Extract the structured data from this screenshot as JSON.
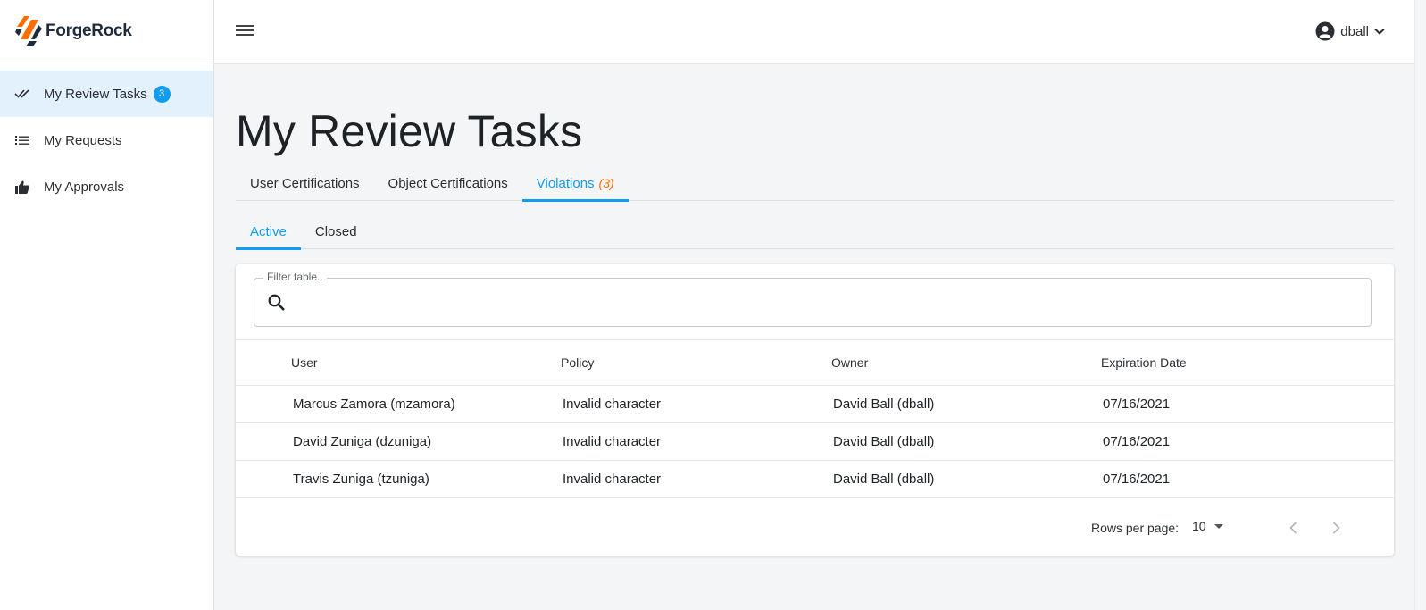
{
  "brand": {
    "name": "ForgeRock"
  },
  "sidebar": {
    "items": [
      {
        "label": "My Review Tasks",
        "icon": "double-check-icon",
        "badge": "3",
        "active": true
      },
      {
        "label": "My Requests",
        "icon": "list-icon"
      },
      {
        "label": "My Approvals",
        "icon": "thumbs-up-icon"
      }
    ]
  },
  "header": {
    "username": "dball"
  },
  "page": {
    "title": "My Review Tasks"
  },
  "tabs": [
    {
      "label": "User Certifications"
    },
    {
      "label": "Object Certifications"
    },
    {
      "label": "Violations",
      "count": "(3)",
      "active": true
    }
  ],
  "subtabs": [
    {
      "label": "Active",
      "active": true
    },
    {
      "label": "Closed"
    }
  ],
  "filter": {
    "label": "Filter table..",
    "value": ""
  },
  "table": {
    "columns": [
      "User",
      "Policy",
      "Owner",
      "Expiration Date"
    ],
    "rows": [
      [
        "Marcus Zamora (mzamora)",
        "Invalid character",
        "David Ball (dball)",
        "07/16/2021"
      ],
      [
        "David Zuniga (dzuniga)",
        "Invalid character",
        "David Ball (dball)",
        "07/16/2021"
      ],
      [
        "Travis Zuniga (tzuniga)",
        "Invalid character",
        "David Ball (dball)",
        "07/16/2021"
      ]
    ]
  },
  "pagination": {
    "rows_per_page_label": "Rows per page:",
    "rows_per_page": "10"
  },
  "colors": {
    "accent": "#109cf1",
    "count": "#ff6d00",
    "logo_orange": "#ff6d00",
    "logo_navy": "#1f2a3d"
  }
}
